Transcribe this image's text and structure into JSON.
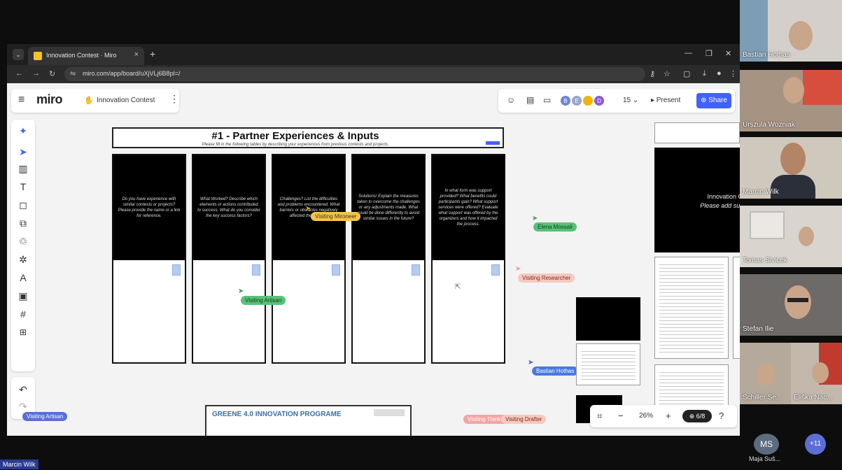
{
  "browser": {
    "tab_title": "Innovation Contest · Miro",
    "tab_close": "×",
    "tab_new": "+",
    "url": "miro.com/app/board/uXjVLj6B8pl=/",
    "win_min": "—",
    "win_max": "❐",
    "win_close": "✕"
  },
  "miro": {
    "logo": "miro",
    "board_name": "Innovation Contest",
    "collaborator_count": "15",
    "present_label": "▸ Present",
    "share_label": "⊕ Share",
    "avatars": [
      "B",
      "E",
      "",
      "D"
    ],
    "avatar_colors": [
      "#6e84d8",
      "#9aa6c7",
      "#f2b400",
      "#8e5ad9"
    ]
  },
  "frame": {
    "title": "#1 - Partner Experiences & Inputs",
    "subtitle": "Please fill in the following tables by describing your experiences from previous contests and projects.",
    "columns": [
      "Do you have experience with similar contests or projects? Please provide the name or a link for reference.",
      "What Worked? Describe which elements or actions contributed to success. What do you consider the key success factors?",
      "Challenges? List the difficulties and problems encountered. What barriers or obstacles negatively affected the project?",
      "Solutions! Explain the measures taken to overcome the challenges or any adjustments made. What could be done differently to avoid similar issues in the future?",
      "In what form was support provided? What benefits could participants gain? What support services were offered? Evaluate what support was offered by the organizers and how it impacted the process."
    ]
  },
  "cursors": [
    {
      "label": "Visiting Mironeer",
      "color": "#f5c542",
      "text": "#333"
    },
    {
      "label": "Elena Mossali",
      "color": "#59c178",
      "text": "#0d3d1c"
    },
    {
      "label": "Visiting Researcher",
      "color": "#f7c9c0",
      "text": "#7a2a20"
    },
    {
      "label": "Visiting Artisan",
      "color": "#59c178",
      "text": "#0d3d1c"
    },
    {
      "label": "Bastian Hothas",
      "color": "#4a79e0",
      "text": "#fff"
    },
    {
      "label": "Visiting Thinker",
      "color": "#f5a3a3",
      "text": "#fff"
    },
    {
      "label": "Visiting Drafter",
      "color": "#f7c9c0",
      "text": "#7a2a20"
    },
    {
      "label": "Visiting Artisan",
      "color": "#5a6fd6",
      "text": "#fff"
    }
  ],
  "right_board": {
    "title": "Innovation Contest",
    "subtitle": "Please add suggestions"
  },
  "greene": {
    "title": "GREENE 4.0 INNOVATION PROGRAME"
  },
  "zoom": {
    "value": "26%",
    "page": "⊕ 6/8"
  },
  "participants": [
    {
      "name": "Bastian Hothas"
    },
    {
      "name": "Urszula Wozniak"
    },
    {
      "name": "Marcin Wilk"
    },
    {
      "name": "Tomas Sivicek"
    },
    {
      "name": "Stefan Ilie"
    },
    {
      "name": "Schiller Se..."
    },
    {
      "name": "Eliška Nac..."
    }
  ],
  "extra_participant": {
    "initials": "MS",
    "name": "Maja Suš..."
  },
  "more_count": "+11",
  "self_name": "Marcin Wilk"
}
